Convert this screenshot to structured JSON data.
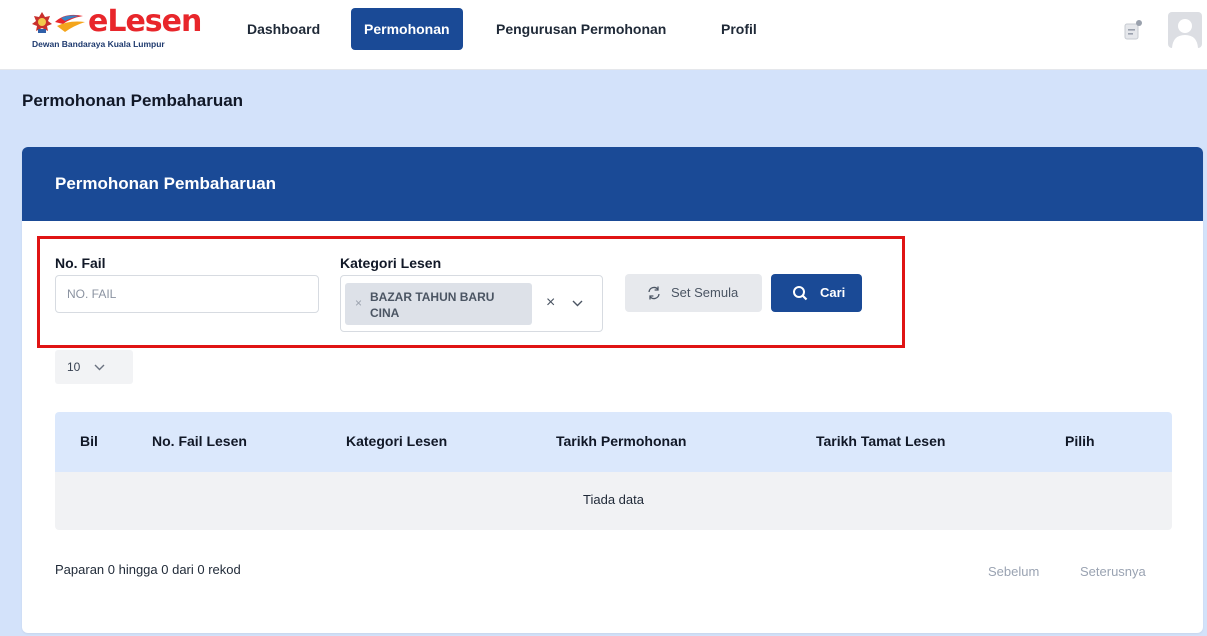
{
  "app": {
    "brand": "eLesen",
    "brand_subtitle": "Dewan Bandaraya Kuala Lumpur"
  },
  "nav": {
    "items": [
      {
        "label": "Dashboard",
        "active": false
      },
      {
        "label": "Permohonan",
        "active": true
      },
      {
        "label": "Pengurusan Permohonan",
        "active": false
      },
      {
        "label": "Profil",
        "active": false
      }
    ],
    "icons": [
      "notification-icon",
      "user-avatar-icon"
    ]
  },
  "page": {
    "title": "Permohonan Pembaharuan"
  },
  "card": {
    "title": "Permohonan Pembaharuan"
  },
  "filters": {
    "no_fail": {
      "label": "No. Fail",
      "placeholder": "NO. FAIL",
      "value": ""
    },
    "kategori": {
      "label": "Kategori Lesen",
      "selected": [
        "BAZAR TAHUN BARU CINA"
      ]
    },
    "reset_label": "Set Semula",
    "search_label": "Cari"
  },
  "pagination": {
    "page_size": "10",
    "info": "Paparan 0 hingga 0 dari 0 rekod",
    "prev_label": "Sebelum",
    "next_label": "Seterusnya"
  },
  "table": {
    "columns": [
      "Bil",
      "No. Fail Lesen",
      "Kategori Lesen",
      "Tarikh Permohonan",
      "Tarikh Tamat Lesen",
      "Pilih"
    ],
    "empty_text": "Tiada data"
  },
  "colors": {
    "primary": "#1a4a96",
    "brand_red": "#e8262b",
    "highlight": "#e01414",
    "page_bg": "#d3e2fa",
    "table_header": "#dbe8fc"
  }
}
